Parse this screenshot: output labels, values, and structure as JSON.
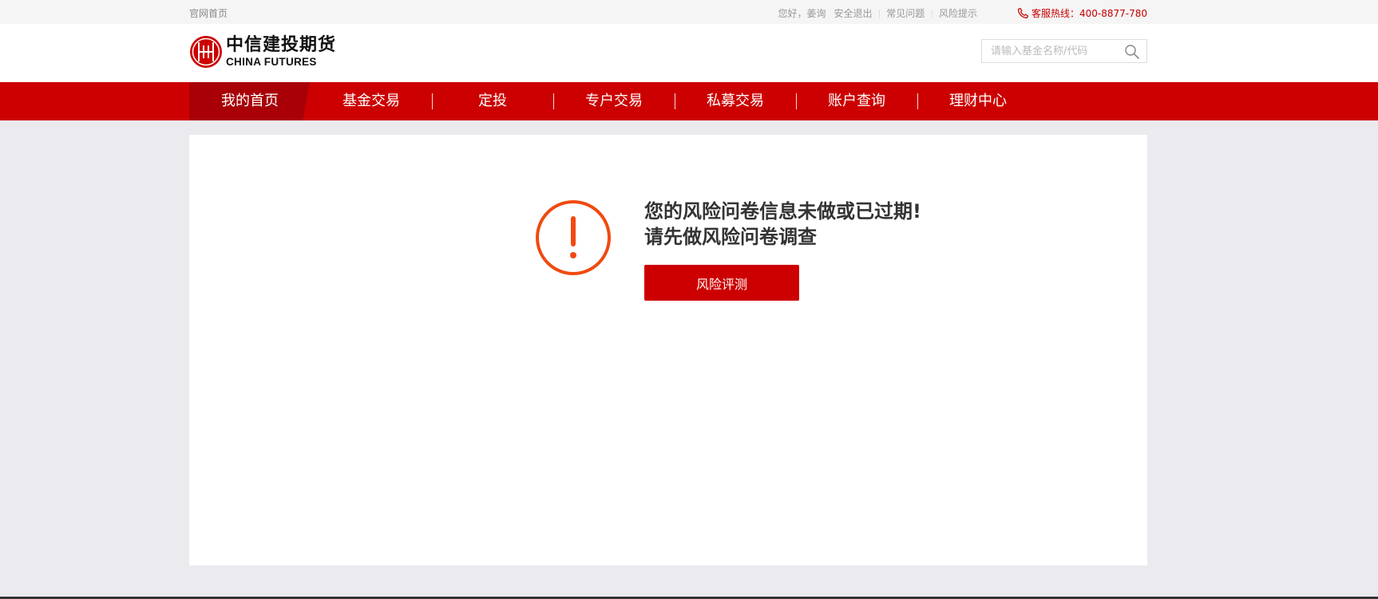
{
  "topbar": {
    "home_link": "官网首页",
    "greeting": "您好，姜询",
    "logout": "安全退出",
    "faq": "常见问题",
    "risk_notice": "风险提示",
    "hotline": "客服热线：400-8877-780"
  },
  "header": {
    "logo_cn": "中信建投期货",
    "logo_en": "CHINA FUTURES",
    "search_placeholder": "请输入基金名称/代码"
  },
  "nav": {
    "items": [
      {
        "label": "我的首页",
        "active": true
      },
      {
        "label": "基金交易"
      },
      {
        "label": "定投"
      },
      {
        "label": "专户交易"
      },
      {
        "label": "私募交易"
      },
      {
        "label": "账户查询"
      },
      {
        "label": "理财中心"
      }
    ]
  },
  "main": {
    "message_line1": "您的风险问卷信息未做或已过期!",
    "message_line2": "请先做风险问卷调查",
    "button_label": "风险评测"
  },
  "colors": {
    "brand_red": "#cc0000",
    "active_nav": "#a80006",
    "warning_orange": "#f04a10"
  },
  "icons": [
    "phone-icon",
    "search-icon",
    "warning-icon",
    "logo-emblem-icon"
  ]
}
